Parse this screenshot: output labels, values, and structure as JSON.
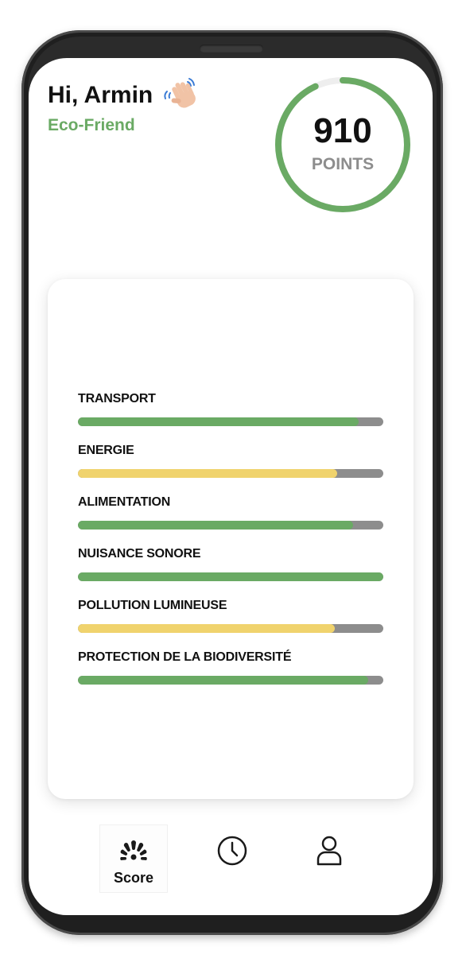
{
  "header": {
    "greeting": "Hi, Armin",
    "level": "Eco-Friend",
    "wave_icon": "waving-hand-icon"
  },
  "score": {
    "value": "910",
    "label": "POINTS",
    "progress": 0.93,
    "ring_color": "#6aaa64",
    "track_color": "#eeeeee"
  },
  "categories": [
    {
      "label": "TRANSPORT",
      "value": 0.92,
      "color": "#6aaa64"
    },
    {
      "label": "ENERGIE",
      "value": 0.85,
      "color": "#f0d36d"
    },
    {
      "label": "ALIMENTATION",
      "value": 0.9,
      "color": "#6aaa64"
    },
    {
      "label": "NUISANCE SONORE",
      "value": 1.0,
      "color": "#6aaa64"
    },
    {
      "label": "POLLUTION LUMINEUSE",
      "value": 0.84,
      "color": "#f0d36d"
    },
    {
      "label": "PROTECTION DE LA BIODIVERSITÉ",
      "value": 0.95,
      "color": "#6aaa64"
    }
  ],
  "nav": {
    "score_label": "Score",
    "score_icon": "gauge-icon",
    "history_icon": "clock-icon",
    "profile_icon": "user-icon"
  },
  "colors": {
    "green": "#6aaa64",
    "yellow": "#f0d36d",
    "track": "#8d8d8d"
  }
}
